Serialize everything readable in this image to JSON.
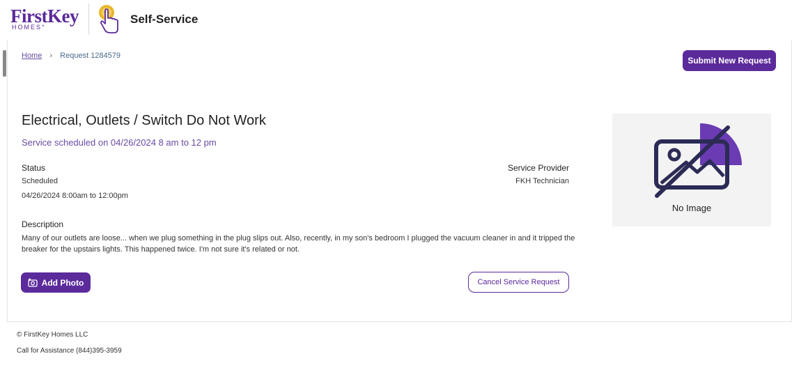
{
  "header": {
    "logo_main": "FirstKey",
    "logo_sub": "HOMES°",
    "title": "Self-Service"
  },
  "breadcrumb": {
    "home": "Home",
    "separator": "›",
    "current": "Request 1284579"
  },
  "actions": {
    "submit_new": "Submit New Request",
    "add_photo": "Add Photo",
    "cancel": "Cancel Service Request"
  },
  "request": {
    "title": "Electrical, Outlets / Switch Do Not Work",
    "scheduled_line": "Service scheduled on  04/26/2024 8 am to 12 pm",
    "status_label": "Status",
    "status_value": "Scheduled",
    "status_window": "04/26/2024 8:00am to 12:00pm",
    "provider_label": "Service Provider",
    "provider_value": "FKH Technician",
    "description_label": "Description",
    "description_text": "Many of our outlets are loose... when we plug something in the plug slips out. Also, recently, in my son's bedroom I plugged the vacuum cleaner in and it tripped the breaker for the upstairs lights. This happened twice. I'm not sure it's related or not."
  },
  "image_placeholder": {
    "label": "No Image",
    "icon": "no-image-icon"
  },
  "footer": {
    "copyright": "© FirstKey Homes LLC",
    "assistance": "Call for Assistance (844)395-3959"
  },
  "colors": {
    "brand_purple": "#5b2a9b",
    "accent_purple": "#6a4ba3",
    "gold": "#e8b62c"
  }
}
